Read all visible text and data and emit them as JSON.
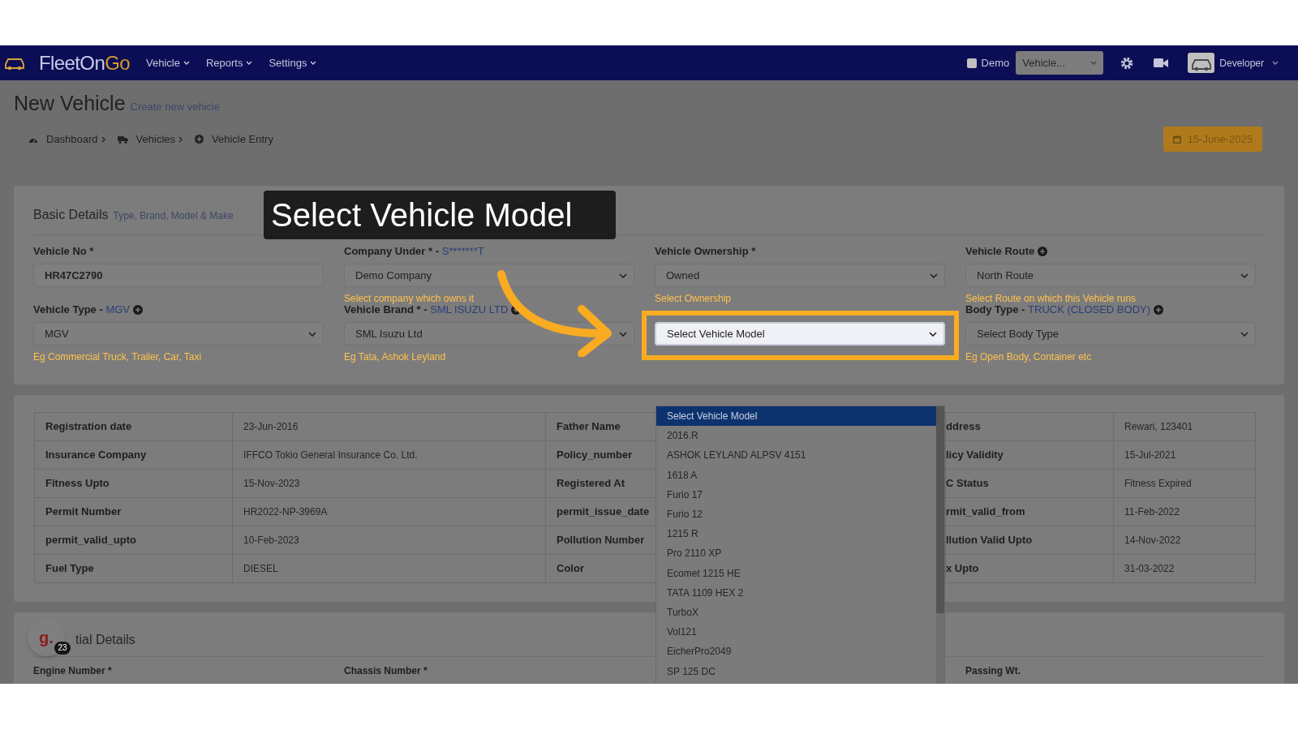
{
  "navbar": {
    "logo": {
      "text": "FleetOn",
      "accent": "Go"
    },
    "menus": [
      {
        "label": "Vehicle"
      },
      {
        "label": "Reports"
      },
      {
        "label": "Settings"
      }
    ],
    "demo": {
      "label": "Demo",
      "checked": false
    },
    "vehicle_select": {
      "value": "Vehicle..."
    },
    "user": {
      "label": "Developer"
    }
  },
  "page": {
    "title": "New Vehicle",
    "subtitle": "Create new vehicle",
    "breadcrumb": [
      {
        "label": "Dashboard"
      },
      {
        "label": "Vehicles"
      },
      {
        "label": "Vehicle Entry"
      }
    ],
    "date": "15-June-2025"
  },
  "tooltip": "Select Vehicle Model",
  "basic_details": {
    "title": "Basic Details",
    "subtitle": "Type, Brand, Model & Make",
    "fields": [
      {
        "kind": "text",
        "label": "Vehicle No *",
        "value": "HR47C2790",
        "highlighted": false
      },
      {
        "kind": "select",
        "label": "Company Under * -",
        "note": "S*******T",
        "value": "Demo Company",
        "hint": "Select company which owns it",
        "highlighted": false
      },
      {
        "kind": "select",
        "label": "Vehicle Ownership *",
        "value": "Owned",
        "hint": "Select Ownership",
        "highlighted": false
      },
      {
        "kind": "select",
        "label": "Vehicle Route",
        "add": true,
        "value": "North Route",
        "hint": "Select Route on which this Vehicle runs",
        "highlighted": false
      },
      {
        "kind": "select",
        "label": "Vehicle Type -",
        "note": "MGV",
        "add": true,
        "value": "MGV",
        "hint": "Eg Commercial Truck, Trailer, Car, Taxi",
        "highlighted": false
      },
      {
        "kind": "select",
        "label": "Vehicle Brand * -",
        "note": "SML ISUZU LTD",
        "add": true,
        "value": "SML Isuzu Ltd",
        "hint": "Eg Tata, Ashok Leyland",
        "highlighted": false
      },
      {
        "kind": "select",
        "value": "Select Vehicle Model",
        "highlighted": true
      },
      {
        "kind": "select",
        "label": "Body Type -",
        "note": "TRUCK (CLOSED BODY)",
        "add": true,
        "value": "Select Body Type",
        "hint": "Eg Open Body, Container etc",
        "highlighted": false
      }
    ]
  },
  "details_table": {
    "rows": [
      [
        "Registration date",
        "23-Jun-2016",
        "Father Name",
        "ddress",
        "Rewari, 123401"
      ],
      [
        "Insurance Company",
        "IFFCO Tokio General Insurance Co. Ltd.",
        "Policy_number",
        "licy Validity",
        "15-Jul-2021"
      ],
      [
        "Fitness Upto",
        "15-Nov-2023",
        "Registered At",
        "C Status",
        "Fitness Expired"
      ],
      [
        "Permit Number",
        "HR2022-NP-3969A",
        "permit_issue_date",
        "rmit_valid_from",
        "11-Feb-2022"
      ],
      [
        "permit_valid_upto",
        "10-Feb-2023",
        "Pollution Number",
        "llution Valid Upto",
        "14-Nov-2022"
      ],
      [
        "Fuel Type",
        "DIESEL",
        "Color",
        "x Upto",
        "31-03-2022"
      ]
    ]
  },
  "model_dropdown": {
    "options": [
      {
        "label": "Select Vehicle Model",
        "selected": true
      },
      {
        "label": "2016.R",
        "selected": false
      },
      {
        "label": "ASHOK LEYLAND ALPSV 4151",
        "selected": false
      },
      {
        "label": "1618 A",
        "selected": false
      },
      {
        "label": "Furio 17",
        "selected": false
      },
      {
        "label": "Furio 12",
        "selected": false
      },
      {
        "label": "1215 R",
        "selected": false
      },
      {
        "label": "Pro 2110 XP",
        "selected": false
      },
      {
        "label": "Ecomet 1215 HE",
        "selected": false
      },
      {
        "label": "TATA 1109 HEX 2",
        "selected": false
      },
      {
        "label": "TurboX",
        "selected": false
      },
      {
        "label": "Vol121",
        "selected": false
      },
      {
        "label": "EicherPro2049",
        "selected": false
      },
      {
        "label": "SP 125 DC",
        "selected": false
      }
    ]
  },
  "initial_details": {
    "title": "tial Details",
    "labels": [
      "Engine Number *",
      "Chassis Number *",
      "Passing Wt."
    ]
  },
  "chat_bubble": {
    "letter": "g.",
    "count": "23"
  }
}
